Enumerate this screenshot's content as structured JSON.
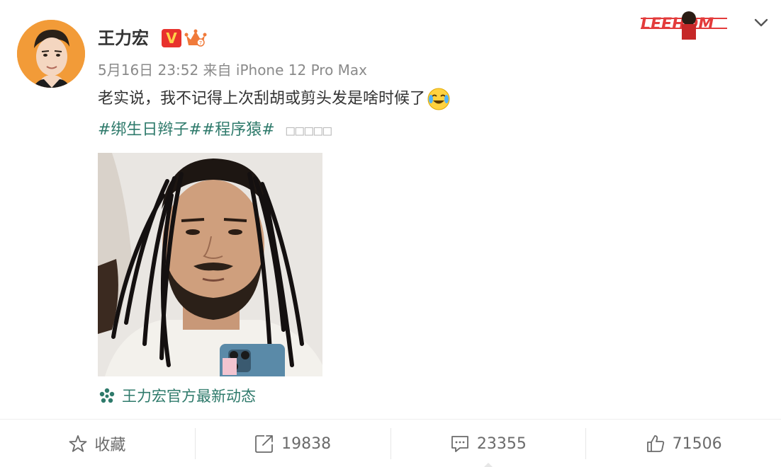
{
  "post": {
    "username": "王力宏",
    "verified_badge": "V",
    "meta": {
      "date": "5月16日",
      "time": "23:52",
      "source_prefix": "来自",
      "device": "iPhone 12 Pro Max"
    },
    "text": "老实说，我不记得上次刮胡或剪头发是啥时候了",
    "emoji_icon": "crying-laughing-emoji-icon",
    "tags": [
      "#绑生日辫子#",
      "#程序猿#"
    ],
    "tag_boxes": "□□□□□",
    "official_link": "王力宏官方最新动态",
    "banner_text": "LEEHOM"
  },
  "actions": {
    "favorite": "收藏",
    "repost": "19838",
    "comment": "23355",
    "like": "71506"
  },
  "colors": {
    "accent_green": "#2e7a6b",
    "muted_gray": "#8a8a8a",
    "avatar_bg": "#f29b38",
    "badge_red": "#e8322d"
  }
}
